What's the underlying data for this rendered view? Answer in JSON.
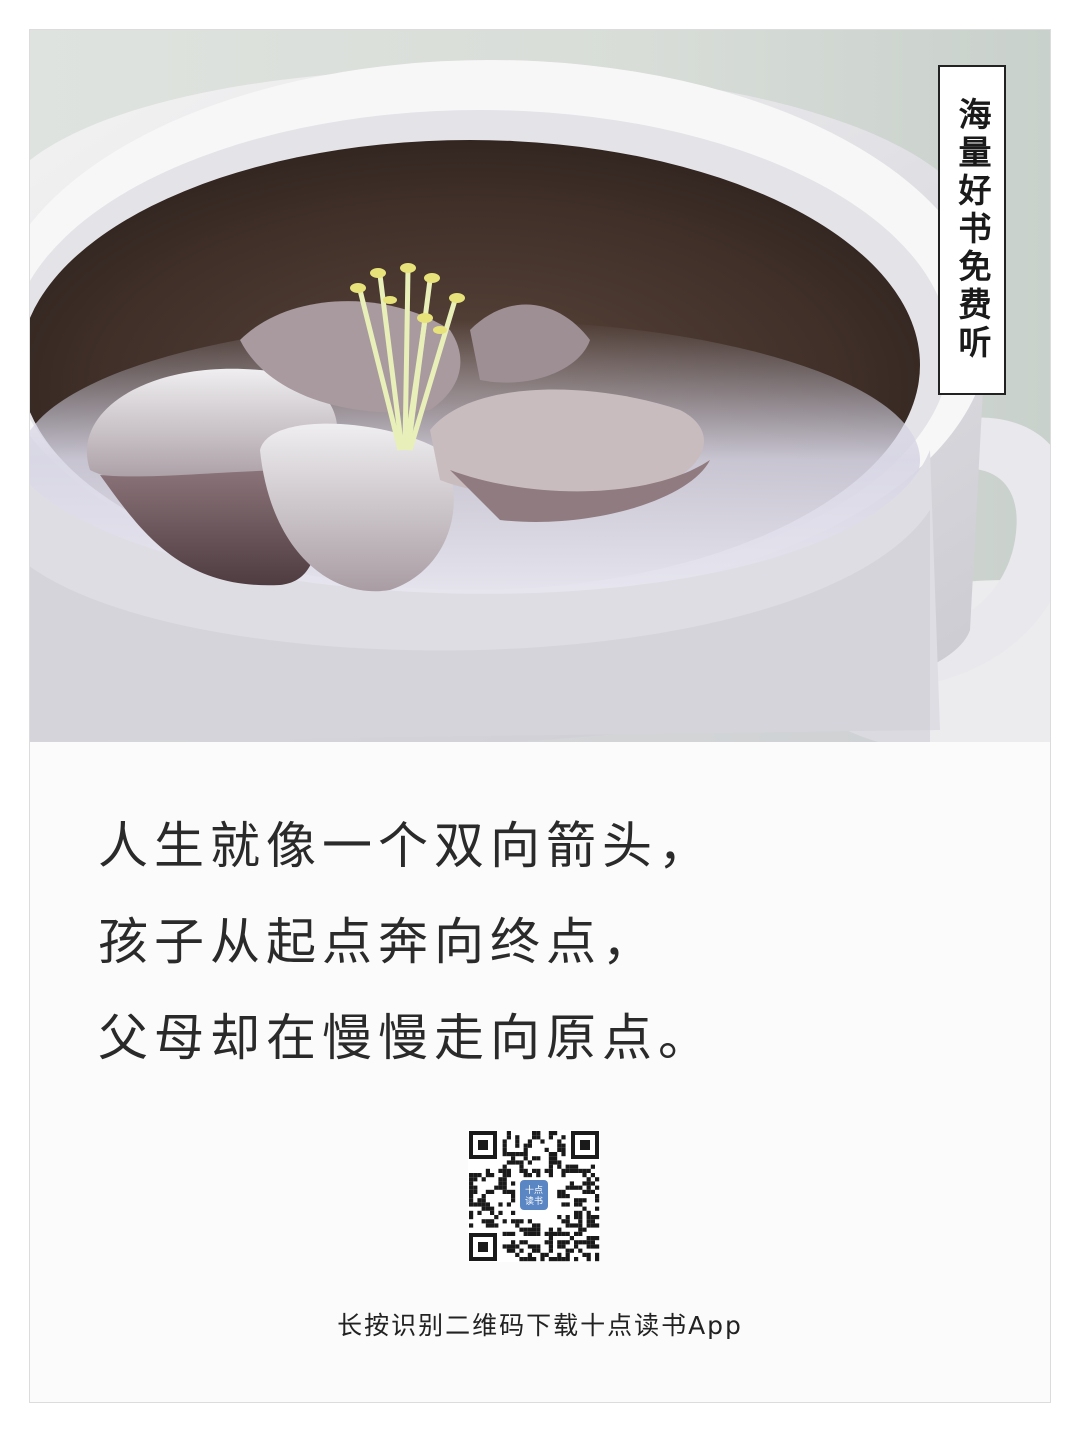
{
  "tag": {
    "text": "海量好书免费听"
  },
  "quote": {
    "lines": [
      "人生就像一个双向箭头，",
      "孩子从起点奔向终点，",
      "父母却在慢慢走向原点。"
    ]
  },
  "qr": {
    "center_logo_line1": "十点",
    "center_logo_line2": "读书",
    "logo_color": "#5b86c4"
  },
  "caption": {
    "text": "长按识别二维码下载十点读书App"
  }
}
